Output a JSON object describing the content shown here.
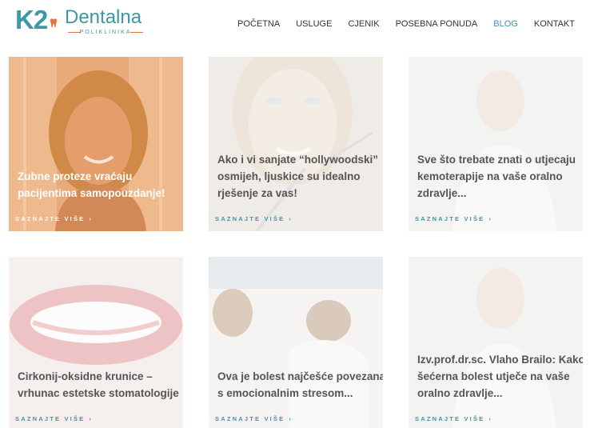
{
  "header": {
    "logo": {
      "mark": "K2",
      "name": "Dentalna",
      "subtitle": "POLIKLINIKA"
    },
    "nav": [
      {
        "label": "POČETNA",
        "active": false
      },
      {
        "label": "USLUGE",
        "active": false
      },
      {
        "label": "CJENIK",
        "active": false
      },
      {
        "label": "POSEBNA PONUDA",
        "active": false
      },
      {
        "label": "BLOG",
        "active": true
      },
      {
        "label": "KONTAKT",
        "active": false
      }
    ]
  },
  "colors": {
    "brand": "#3f96a5",
    "accent": "#e2733c",
    "text": "#333333"
  },
  "posts": [
    {
      "title": "Zubne proteze vraćaju pacijentima samopouzdanje!",
      "more": "SAZNAJTE VIŠE",
      "image": "smiling-woman-photo"
    },
    {
      "title": "Ako i vi sanjate “hollywoodski” osmijeh, ljuskice su idealno rješenje za vas!",
      "more": "SAZNAJTE VIŠE",
      "image": "woman-dental-exam-photo"
    },
    {
      "title": "Sve što trebate znati o utjecaju kemoterapije na vaše oralno zdravlje...",
      "more": "SAZNAJTE VIŠE",
      "image": "doctor-portrait-photo"
    },
    {
      "title": "Cirkonij-oksidne krunice – vrhunac estetske stomatologije",
      "more": "SAZNAJTE VIŠE",
      "image": "smile-closeup-photo"
    },
    {
      "title": "Ova je bolest najčešće povezana s emocionalnim stresom...",
      "more": "SAZNAJTE VIŠE",
      "image": "couple-in-bed-photo"
    },
    {
      "title": "Izv.prof.dr.sc. Vlaho Brailo: Kako šećerna bolest utječe na vaše oralno zdravlje...",
      "more": "SAZNAJTE VIŠE",
      "image": "doctor-portrait-photo"
    }
  ]
}
